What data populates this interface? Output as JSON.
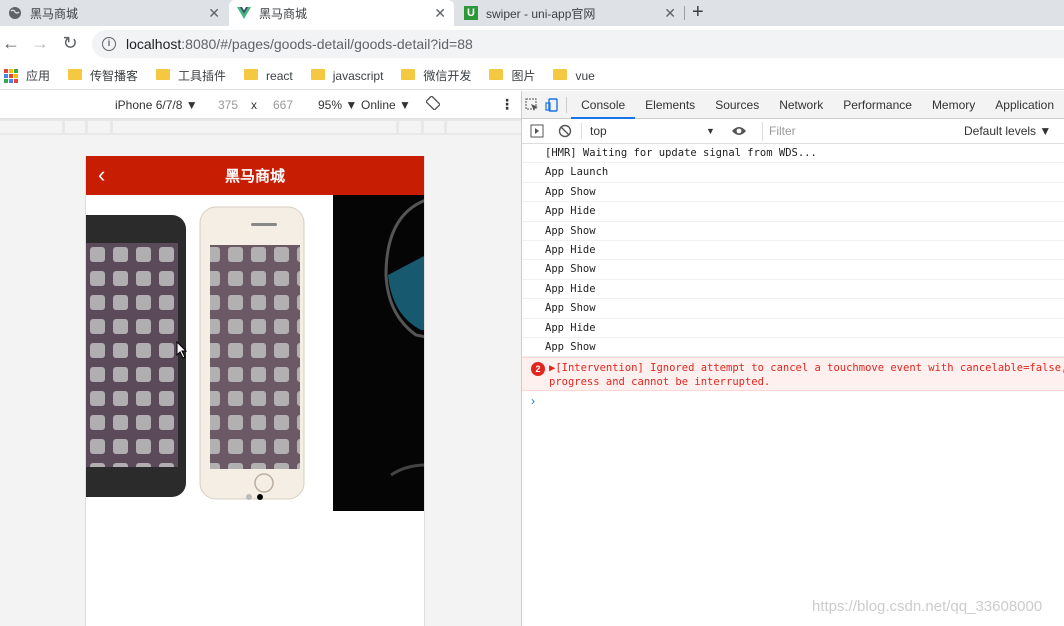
{
  "tabs": [
    {
      "title": "黑马商城",
      "icon": "globe-icon",
      "active": false
    },
    {
      "title": "黑马商城",
      "icon": "vue-logo-icon",
      "active": true
    },
    {
      "title": "swiper - uni-app官网",
      "icon": "uniapp-logo-icon",
      "active": false
    }
  ],
  "address": {
    "host": "localhost",
    "rest": ":8080/#/pages/goods-detail/goods-detail?id=88"
  },
  "bookmarks": [
    {
      "label": "应用",
      "icon": "apps-grid-icon"
    },
    {
      "label": "传智播客",
      "icon": "folder-icon"
    },
    {
      "label": "工具插件",
      "icon": "folder-icon"
    },
    {
      "label": "react",
      "icon": "folder-icon"
    },
    {
      "label": "javascript",
      "icon": "folder-icon"
    },
    {
      "label": "微信开发",
      "icon": "folder-icon"
    },
    {
      "label": "图片",
      "icon": "folder-icon"
    },
    {
      "label": "vue",
      "icon": "folder-icon"
    }
  ],
  "device_toolbar": {
    "device": "iPhone 6/7/8 ▼",
    "width": "375",
    "times": "x",
    "height": "667",
    "zoom": "95% ▼",
    "network": "Online ▼"
  },
  "phone": {
    "nav_title": "黑马商城",
    "back": "‹",
    "swiper_dots": 2,
    "active_dot": 1
  },
  "devtools": {
    "tabs": [
      "Console",
      "Elements",
      "Sources",
      "Network",
      "Performance",
      "Memory",
      "Application"
    ],
    "active_tab": "Console",
    "context": "top",
    "filter_placeholder": "Filter",
    "levels": "Default levels ▼",
    "logs": [
      "[HMR] Waiting for update signal from WDS...",
      "App Launch",
      "App Show",
      "App Hide",
      "App Show",
      "App Hide",
      "App Show",
      "App Hide",
      "App Show",
      "App Hide",
      "App Show"
    ],
    "error": {
      "count": "2",
      "line1": "▶[Intervention] Ignored attempt to cancel a touchmove event with cancelable=false,",
      "line2": "progress and cannot be interrupted."
    },
    "prompt": "›"
  },
  "watermark": "https://blog.csdn.net/qq_33608000",
  "colors": {
    "nav_red": "#c71d02",
    "devtools_accent": "#1a73e8",
    "error_red": "#e0261e"
  }
}
